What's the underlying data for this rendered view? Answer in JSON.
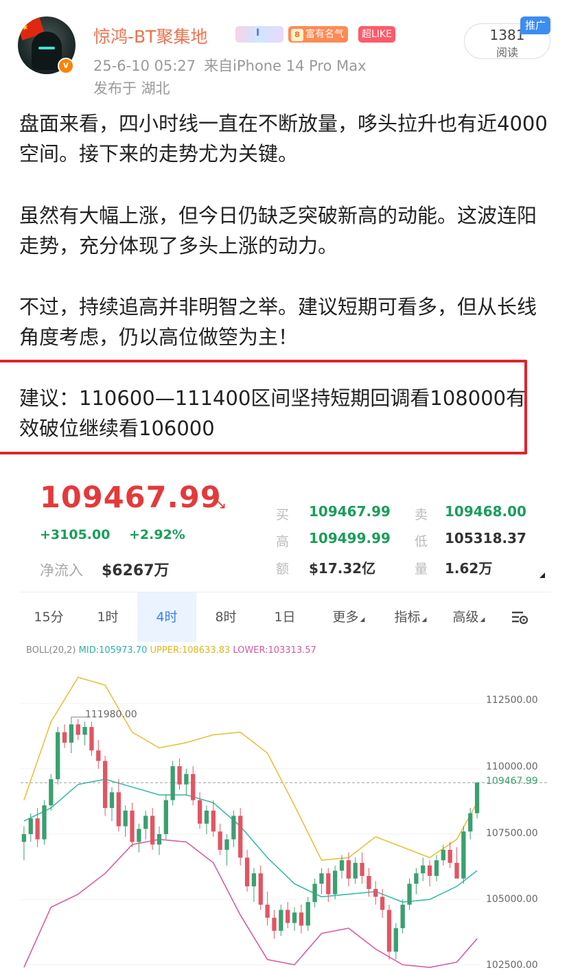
{
  "user": {
    "name": "惊鸿-BT聚集地",
    "verified_mark": "v",
    "fame_badge": "富有名气",
    "fame_level": "8",
    "emblem_text": "I",
    "like_badge": "超LIKE",
    "timestamp": "25-6-10 05:27",
    "source": "来自iPhone 14 Pro Max",
    "location": "发布于 湖北"
  },
  "stats": {
    "read_count": "1381",
    "read_label": "阅读",
    "promo_tag": "推广"
  },
  "post": {
    "para1": "盘面来看，四小时线一直在不断放量，哆头拉升也有近4000空间。接下来的走势尤为关键。",
    "para2": "虽然有大幅上涨，但今日仍缺乏突破新高的动能。这波连阳走势，充分体现了多头上涨的动力。",
    "para3": "不过，持续追高并非明智之举。建议短期可看多，但从长线角度考虑，仍以高位做箜为主！",
    "advice": "建议：110600—111400区间坚持短期回调看108000有效破位继续看106000"
  },
  "ticker": {
    "price": "109467.99",
    "change_abs": "+3105.00",
    "change_pct": "+2.92%",
    "net_inflow_label": "净流入",
    "net_inflow": "$6267万",
    "buy_label": "买",
    "buy": "109467.99",
    "sell_label": "卖",
    "sell": "109468.00",
    "high_label": "高",
    "high": "109499.99",
    "low_label": "低",
    "low": "105318.37",
    "amount_label": "额",
    "amount": "$17.32亿",
    "volume_label": "量",
    "volume": "1.62万",
    "colors": {
      "up": "#e5393a",
      "down": "#1a9e5a"
    }
  },
  "intervals": {
    "tabs": [
      "15分",
      "1时",
      "4时",
      "8时",
      "1日",
      "更多",
      "指标",
      "高级"
    ],
    "active": "4时",
    "settings_icon": "chart-settings-icon"
  },
  "indicator": {
    "name": "BOLL(20,2)",
    "mid": "MID:105973.70",
    "upper": "UPPER:108633.83",
    "lower": "LOWER:103313.57"
  },
  "chart_data": {
    "type": "candlestick",
    "y_ticks": [
      "112500.00",
      "110000.00",
      "107500.00",
      "105000.00",
      "102500.00"
    ],
    "y_range": [
      102300,
      114200
    ],
    "current_price_label": "109467.99",
    "high_marker": "111980.00",
    "candles": [
      [
        107200,
        107800,
        106500,
        107500
      ],
      [
        107500,
        108300,
        107200,
        108100
      ],
      [
        108100,
        108500,
        107000,
        107300
      ],
      [
        107300,
        108800,
        107100,
        108600
      ],
      [
        108600,
        109800,
        108400,
        109600
      ],
      [
        109600,
        111600,
        109400,
        111400
      ],
      [
        111400,
        111700,
        110800,
        111000
      ],
      [
        111000,
        111980,
        110600,
        111700
      ],
      [
        111700,
        111900,
        111100,
        111300
      ],
      [
        111300,
        111800,
        110900,
        111600
      ],
      [
        111600,
        111800,
        110500,
        110700
      ],
      [
        110700,
        111100,
        110000,
        110300
      ],
      [
        110300,
        110500,
        108200,
        108500
      ],
      [
        108500,
        109300,
        108000,
        109100
      ],
      [
        109100,
        109600,
        107600,
        107800
      ],
      [
        107800,
        108600,
        107400,
        108400
      ],
      [
        108400,
        108700,
        107000,
        107200
      ],
      [
        107200,
        107900,
        106800,
        107700
      ],
      [
        107700,
        108400,
        107300,
        108200
      ],
      [
        108200,
        108500,
        106900,
        107100
      ],
      [
        107100,
        107800,
        106700,
        107500
      ],
      [
        107500,
        109000,
        107300,
        108800
      ],
      [
        108800,
        110300,
        108600,
        110100
      ],
      [
        110100,
        110400,
        109200,
        109400
      ],
      [
        109400,
        110000,
        109000,
        109800
      ],
      [
        109800,
        110100,
        108600,
        108800
      ],
      [
        108800,
        109100,
        107700,
        107900
      ],
      [
        107900,
        108600,
        107500,
        108400
      ],
      [
        108400,
        108800,
        107400,
        107600
      ],
      [
        107600,
        107900,
        106700,
        106900
      ],
      [
        106900,
        107500,
        106300,
        107300
      ],
      [
        107300,
        108400,
        107000,
        108200
      ],
      [
        108200,
        108500,
        106300,
        106600
      ],
      [
        106600,
        106900,
        105300,
        105500
      ],
      [
        105500,
        106200,
        104900,
        106000
      ],
      [
        106000,
        106300,
        104600,
        104800
      ],
      [
        104800,
        105300,
        104000,
        104300
      ],
      [
        104300,
        104600,
        103500,
        103800
      ],
      [
        103800,
        104800,
        103600,
        104600
      ],
      [
        104600,
        104900,
        103900,
        104100
      ],
      [
        104100,
        104700,
        103800,
        104500
      ],
      [
        104500,
        104800,
        103700,
        104000
      ],
      [
        104000,
        105100,
        103800,
        104900
      ],
      [
        104900,
        105800,
        104700,
        105600
      ],
      [
        105600,
        106200,
        105200,
        106000
      ],
      [
        106000,
        106200,
        104900,
        105200
      ],
      [
        105200,
        106300,
        105000,
        106100
      ],
      [
        106100,
        106700,
        105800,
        106500
      ],
      [
        106500,
        106800,
        105500,
        105800
      ],
      [
        105800,
        106600,
        105600,
        106400
      ],
      [
        106400,
        106800,
        105600,
        105900
      ],
      [
        105900,
        106200,
        105100,
        105400
      ],
      [
        105400,
        105700,
        104800,
        105100
      ],
      [
        105100,
        105400,
        104300,
        104600
      ],
      [
        104600,
        104800,
        102700,
        103000
      ],
      [
        103000,
        104100,
        102700,
        103900
      ],
      [
        103900,
        105000,
        103700,
        104800
      ],
      [
        104800,
        105800,
        104600,
        105600
      ],
      [
        105600,
        106200,
        105200,
        106000
      ],
      [
        106000,
        106600,
        105700,
        106300
      ],
      [
        106300,
        106500,
        105500,
        105900
      ],
      [
        105900,
        106700,
        105700,
        106500
      ],
      [
        106500,
        107100,
        106300,
        106900
      ],
      [
        106900,
        107200,
        106200,
        106400
      ],
      [
        106400,
        107000,
        106000,
        105800
      ],
      [
        105800,
        107800,
        105600,
        107600
      ],
      [
        107600,
        108500,
        107300,
        108300
      ],
      [
        108300,
        109500,
        108100,
        109468
      ]
    ],
    "boll_mid": [
      [
        0,
        108000
      ],
      [
        4,
        108500
      ],
      [
        8,
        109400
      ],
      [
        12,
        109600
      ],
      [
        16,
        109300
      ],
      [
        20,
        109000
      ],
      [
        24,
        109000
      ],
      [
        28,
        108700
      ],
      [
        32,
        107800
      ],
      [
        36,
        106600
      ],
      [
        40,
        105600
      ],
      [
        44,
        105100
      ],
      [
        48,
        105200
      ],
      [
        52,
        105300
      ],
      [
        56,
        104900
      ],
      [
        60,
        105000
      ],
      [
        64,
        105500
      ],
      [
        67,
        106100
      ]
    ],
    "boll_upper": [
      [
        0,
        108800
      ],
      [
        4,
        111800
      ],
      [
        8,
        113500
      ],
      [
        12,
        113200
      ],
      [
        16,
        111400
      ],
      [
        20,
        110800
      ],
      [
        24,
        111000
      ],
      [
        28,
        111300
      ],
      [
        32,
        111400
      ],
      [
        36,
        110600
      ],
      [
        40,
        108600
      ],
      [
        44,
        106500
      ],
      [
        48,
        106600
      ],
      [
        52,
        107400
      ],
      [
        56,
        107000
      ],
      [
        60,
        106600
      ],
      [
        64,
        107300
      ],
      [
        67,
        108700
      ]
    ],
    "boll_lower": [
      [
        0,
        102400
      ],
      [
        4,
        104700
      ],
      [
        8,
        105200
      ],
      [
        12,
        106000
      ],
      [
        16,
        107100
      ],
      [
        20,
        107300
      ],
      [
        24,
        107200
      ],
      [
        28,
        106400
      ],
      [
        32,
        104400
      ],
      [
        36,
        102700
      ],
      [
        40,
        102500
      ],
      [
        44,
        103700
      ],
      [
        48,
        103900
      ],
      [
        52,
        103100
      ],
      [
        56,
        102500
      ],
      [
        60,
        102400
      ],
      [
        64,
        102600
      ],
      [
        67,
        103500
      ]
    ]
  }
}
